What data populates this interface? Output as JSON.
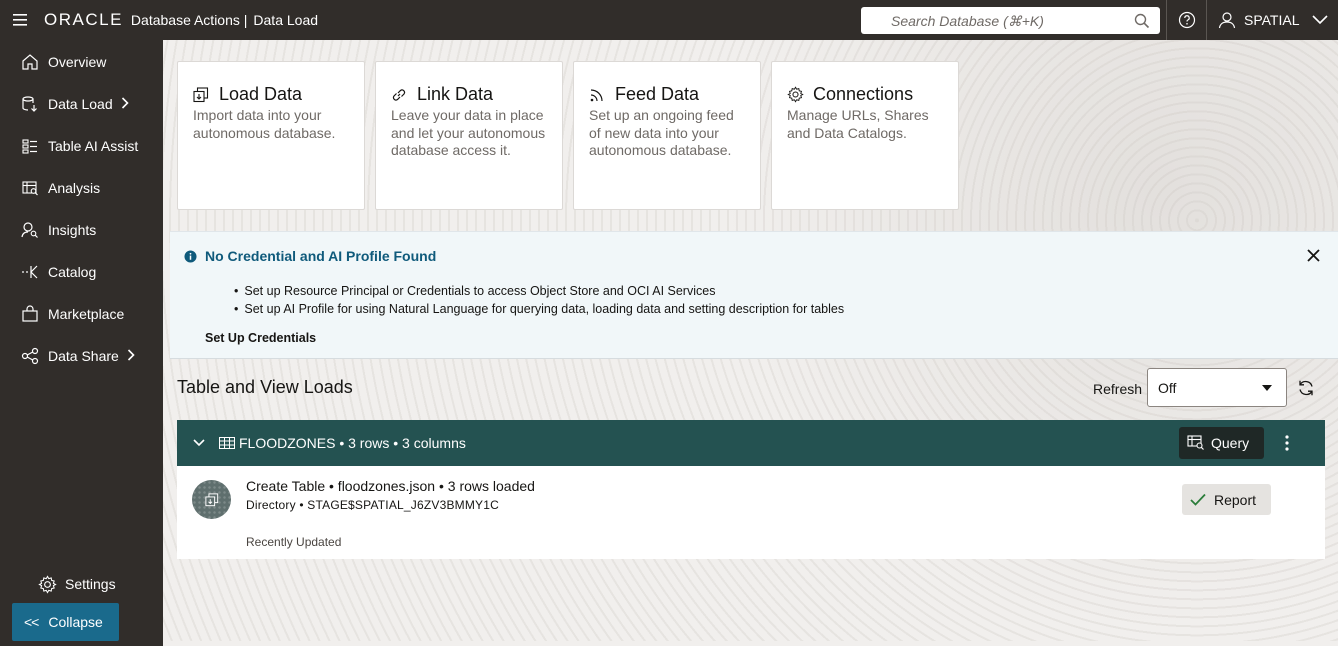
{
  "topbar": {
    "logo_text": "ORACLE",
    "app_title": "Database Actions |",
    "app_section": "Data Load",
    "search_placeholder": "Search Database (⌘+K)",
    "user_name": "SPATIAL"
  },
  "sidebar": {
    "items": [
      {
        "label": "Overview",
        "icon": "home-icon"
      },
      {
        "label": "Data Load",
        "icon": "data-load-icon",
        "has_submenu": true
      },
      {
        "label": "Table AI Assist",
        "icon": "table-ai-icon"
      },
      {
        "label": "Analysis",
        "icon": "analysis-icon"
      },
      {
        "label": "Insights",
        "icon": "insights-icon"
      },
      {
        "label": "Catalog",
        "icon": "catalog-icon"
      },
      {
        "label": "Marketplace",
        "icon": "marketplace-icon"
      },
      {
        "label": "Data Share",
        "icon": "data-share-icon",
        "has_submenu": true
      }
    ],
    "settings_label": "Settings",
    "collapse_label": "Collapse"
  },
  "cards": [
    {
      "title": "Load Data",
      "description": "Import data into your autonomous database.",
      "icon": "load-data-icon"
    },
    {
      "title": "Link Data",
      "description": "Leave your data in place and let your autonomous database access it.",
      "icon": "link-data-icon"
    },
    {
      "title": "Feed Data",
      "description": "Set up an ongoing feed of new data into your autonomous database.",
      "icon": "feed-data-icon"
    },
    {
      "title": "Connections",
      "description": "Manage URLs, Shares and Data Catalogs.",
      "icon": "connections-icon"
    }
  ],
  "banner": {
    "title": "No Credential and AI Profile Found",
    "bullets": [
      "Set up Resource Principal or Credentials to access Object Store and OCI AI Services",
      "Set up AI Profile for using Natural Language for querying data, loading data and setting description for tables"
    ],
    "link_label": "Set Up Credentials"
  },
  "loads_section": {
    "title": "Table and View Loads",
    "refresh_label": "Refresh",
    "refresh_value": "Off"
  },
  "load_group": {
    "title": "FLOODZONES • 3 rows • 3 columns",
    "query_label": "Query",
    "item": {
      "line1": "Create Table • floodzones.json • 3 rows loaded",
      "line2": "Directory • STAGE$SPATIAL_J6ZV3BMMY1C",
      "status": "Recently Updated",
      "report_label": "Report"
    }
  },
  "colors": {
    "topbar_bg": "#312d2a",
    "collapse_bg": "#1a6a8c",
    "load_header_bg": "#245251",
    "banner_title": "#0f5a7b"
  }
}
